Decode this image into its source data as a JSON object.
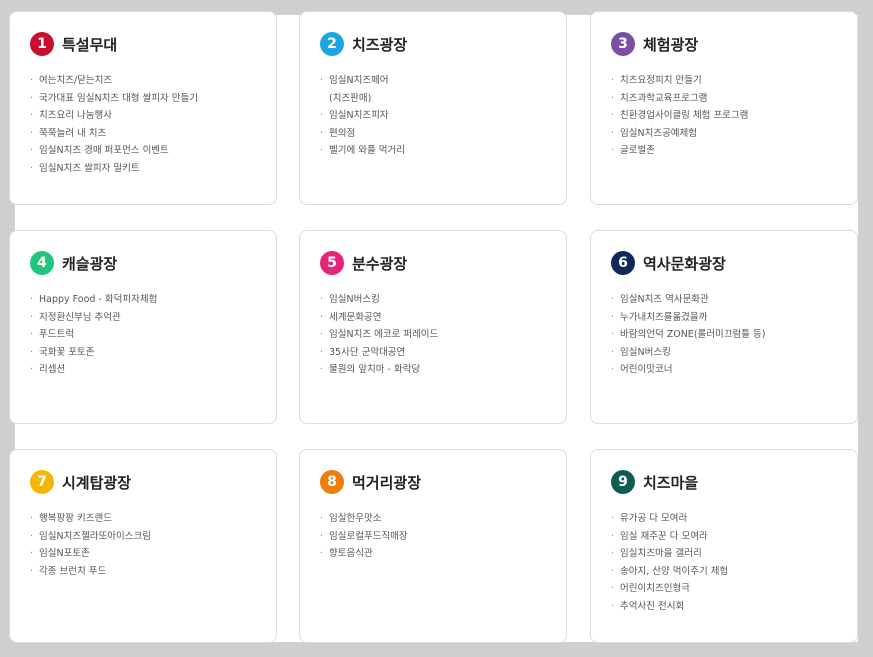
{
  "cards": [
    {
      "num": "1",
      "title": "특설무대",
      "color": "#c8102e",
      "items": [
        "여는치즈/닫는치즈",
        "국가대표 임실N치즈 대형 쌀피자 만들기",
        "치즈요리 나눔행사",
        "쭉쭉늘려 내 치즈",
        "임실N치즈 경매 퍼포먼스 이벤트",
        "임실N치즈 쌀피자 밀키트"
      ]
    },
    {
      "num": "2",
      "title": "치즈광장",
      "color": "#1aa7e0",
      "items": [
        "임실N치즈페어\n(치즈판매)",
        "임실N치즈피자",
        "편의점",
        "벨기에 와플 먹거리"
      ]
    },
    {
      "num": "3",
      "title": "체험광장",
      "color": "#7b4fa6",
      "items": [
        "치즈요정피치 만들기",
        "치즈과학교육프로그램",
        "친환경업사이클링 체험 프로그램",
        "임실N치즈공예체험",
        "글로벌존"
      ]
    },
    {
      "num": "4",
      "title": "캐슬광장",
      "color": "#1fc67e",
      "items": [
        "Happy Food - 화덕피자체험",
        "지정환신부님 추억관",
        "푸드트럭",
        "국화꽃 포토존",
        "리셉션"
      ]
    },
    {
      "num": "5",
      "title": "분수광장",
      "color": "#e6257a",
      "items": [
        "임실N버스킹",
        "세계문화공연",
        "임실N치즈 에코로 퍼레이드",
        "35사단 군악대공연",
        "물원의 앞치마 - 화락당"
      ]
    },
    {
      "num": "6",
      "title": "역사문화광장",
      "color": "#12285a",
      "items": [
        "임실N치즈 역사문화관",
        "누가내치즈를옮겼을까",
        "바람의언덕 ZONE(롤러미끄럼틀 등)",
        "임실N버스킹",
        "어린이맛코너"
      ]
    },
    {
      "num": "7",
      "title": "시계탑광장",
      "color": "#f2b705",
      "items": [
        "행복팡팡 키즈랜드",
        "임실N치즈젤라또아이스크림",
        "임실N포토존",
        "각종 브런치 푸드"
      ]
    },
    {
      "num": "8",
      "title": "먹거리광장",
      "color": "#f07d0a",
      "items": [
        "임실한우맛소",
        "임실로컬푸드직매장",
        "향토음식관"
      ]
    },
    {
      "num": "9",
      "title": "치즈마을",
      "color": "#0f5d52",
      "items": [
        "유가공 다 모여라",
        "임실 재주꾼 다 모여라",
        "임실치즈마을 갤러리",
        "송아지, 산양 먹이주기 체험",
        "어린이치즈인형극",
        "추억사진 전시회"
      ]
    }
  ]
}
